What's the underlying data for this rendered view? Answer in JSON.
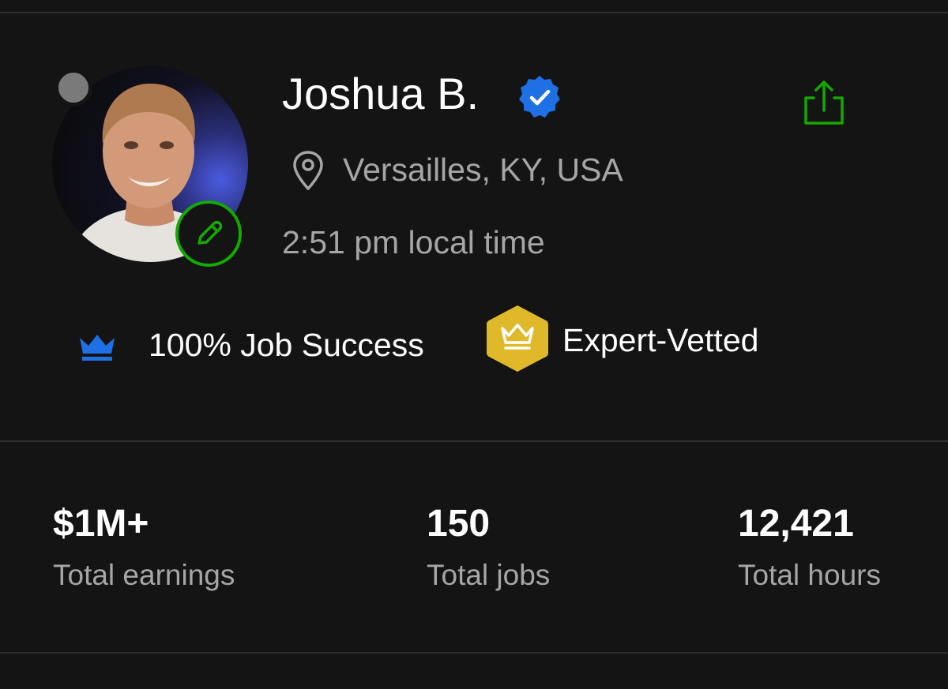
{
  "profile": {
    "name": "Joshua B.",
    "location": "Versailles, KY, USA",
    "local_time": "2:51 pm local time",
    "status": "offline"
  },
  "badges": {
    "job_success": "100% Job Success",
    "expert_vetted": "Expert-Vetted"
  },
  "stats": [
    {
      "value": "$1M+",
      "label": "Total earnings"
    },
    {
      "value": "150",
      "label": "Total jobs"
    },
    {
      "value": "12,421",
      "label": "Total hours"
    }
  ],
  "icons": {
    "verified": "verified-check-icon",
    "share": "share-icon",
    "location": "map-pin-icon",
    "edit": "pencil-icon",
    "job_success": "crown-icon",
    "expert_vetted": "crown-hexagon-icon"
  },
  "colors": {
    "background": "#141414",
    "accent_green": "#14a800",
    "verified_blue": "#1f6fe5",
    "crown_blue": "#1f6fe5",
    "vetted_gold": "#e0b92a",
    "muted_text": "#a6a6a6"
  }
}
